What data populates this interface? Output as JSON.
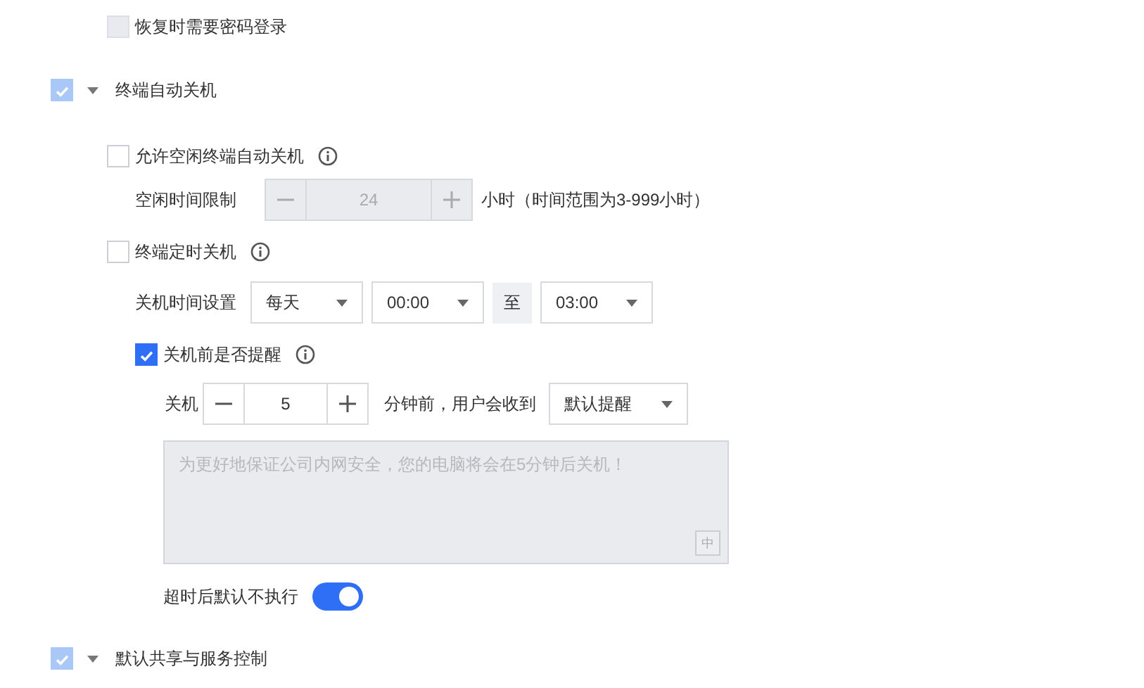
{
  "top_option": {
    "label": "恢复时需要密码登录",
    "checked": false,
    "disabled": true
  },
  "sections": [
    {
      "title": "终端自动关机",
      "checked": true,
      "disabled": true,
      "expanded": true,
      "idle_shutdown": {
        "label": "允许空闲终端自动关机",
        "checked": false,
        "limit_label": "空闲时间限制",
        "value": "24",
        "disabled": true,
        "unit": "小时（时间范围为3-999小时）"
      },
      "scheduled_shutdown": {
        "label": "终端定时关机",
        "checked": false,
        "time_label": "关机时间设置",
        "frequency": "每天",
        "start": "00:00",
        "separator": "至",
        "end": "03:00",
        "reminder": {
          "label": "关机前是否提醒",
          "checked": true,
          "prefix": "关机",
          "minutes": "5",
          "suffix": "分钟前，用户会收到",
          "type": "默认提醒",
          "message_placeholder": "为更好地保证公司内网安全，您的电脑将会在5分钟后关机！",
          "message_disabled": true,
          "ime_indicator": "中"
        },
        "timeout": {
          "label": "超时后默认不执行",
          "on": true
        }
      }
    },
    {
      "title": "默认共享与服务控制",
      "checked": true,
      "disabled": true,
      "expanded": true
    }
  ]
}
